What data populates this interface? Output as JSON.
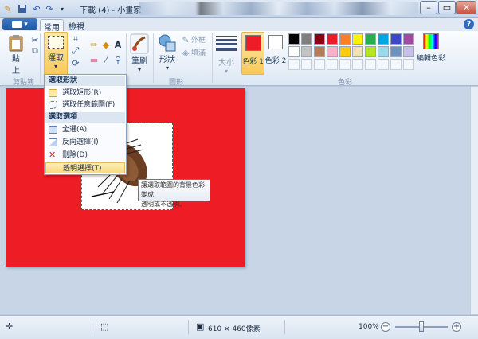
{
  "window": {
    "title": "下載 (4) - 小畫家"
  },
  "tabs": {
    "file": "▾",
    "home": "常用",
    "view": "檢視",
    "help": "?"
  },
  "ribbon": {
    "clipboard": {
      "paste_line1": "貼",
      "paste_line2": "上",
      "group_label": "剪貼簿"
    },
    "image": {
      "select_label": "選取"
    },
    "tools": {},
    "brushes": {
      "label": "筆刷"
    },
    "shapes": {
      "label": "形狀",
      "outline": "外框",
      "fill": "填滿",
      "group_label": "圖形"
    },
    "size": {
      "label": "大小"
    },
    "colors": {
      "color1_label": "色彩 1",
      "color2_label": "色彩 2",
      "edit_label": "編輯色彩",
      "group_label": "色彩",
      "color1": "#ee1c24",
      "color2": "#ffffff",
      "palette_row1": [
        "#000000",
        "#7f7f7f",
        "#880015",
        "#ed1c24",
        "#ff7f27",
        "#fff200",
        "#22b14c",
        "#00a2e8",
        "#3f48cc",
        "#a349a4"
      ],
      "palette_row2": [
        "#ffffff",
        "#c3c3c3",
        "#b97a57",
        "#ffaec9",
        "#ffc90e",
        "#efe4b0",
        "#b5e61d",
        "#99d9ea",
        "#7092be",
        "#c8bfe7"
      ]
    }
  },
  "dropdown": {
    "shape_header": "選取形狀",
    "rect": "選取矩形(R)",
    "freeform": "選取任意範圍(F)",
    "options_header": "選取選項",
    "select_all": "全選(A)",
    "invert": "反向選擇(I)",
    "delete": "刪除(D)",
    "transparent": "透明選擇(T)"
  },
  "tooltip": {
    "line1": "讓選取範圍的背景色彩變成",
    "line2": "透明或不透明。"
  },
  "canvas": {
    "color": "#ee1c24"
  },
  "status": {
    "dimensions": "610 × 460像素",
    "zoom": "100%",
    "zoom_slider_fraction": 0.5
  }
}
